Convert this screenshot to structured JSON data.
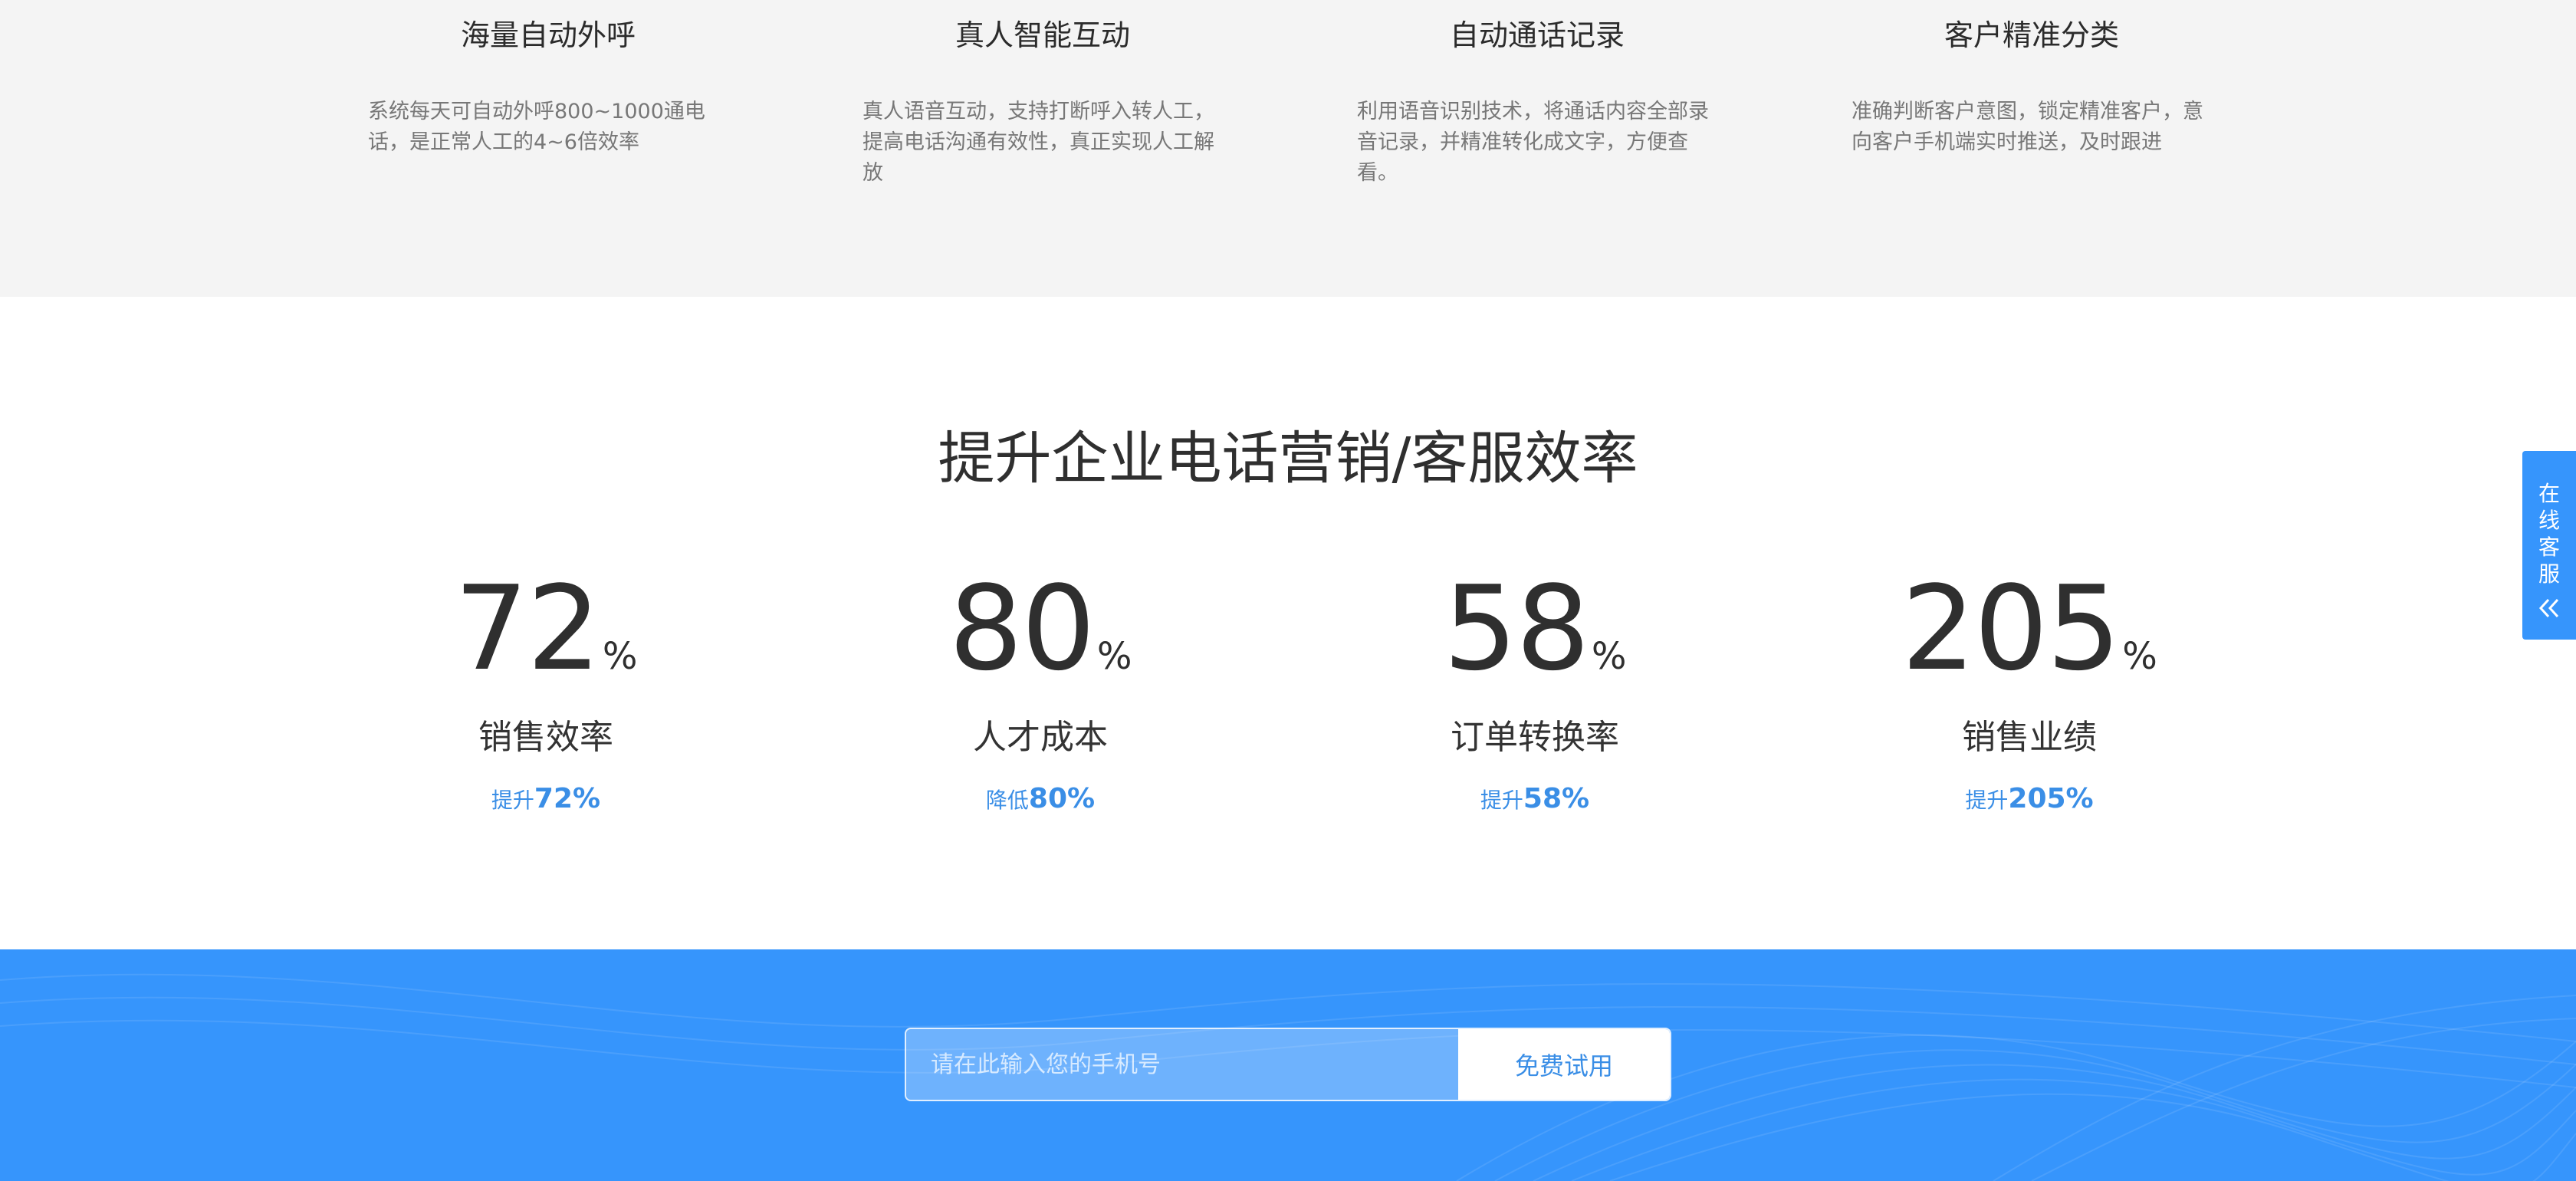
{
  "features": [
    {
      "title": "海量自动外呼",
      "desc": "系统每天可自动外呼800~1000通电话，是正常人工的4~6倍效率"
    },
    {
      "title": "真人智能互动",
      "desc": "真人语音互动，支持打断呼入转人工，提高电话沟通有效性，真正实现人工解放"
    },
    {
      "title": "自动通话记录",
      "desc": "利用语音识别技术，将通话内容全部录音记录，并精准转化成文字，方便查看。"
    },
    {
      "title": "客户精准分类",
      "desc": "准确判断客户意图，锁定精准客户，意向客户手机端实时推送，及时跟进"
    }
  ],
  "stats_section": {
    "title": "提升企业电话营销/客服效率",
    "items": [
      {
        "number": "72",
        "unit": "%",
        "label": "销售效率",
        "sub_prefix": "提升",
        "sub_value": "72%"
      },
      {
        "number": "80",
        "unit": "%",
        "label": "人才成本",
        "sub_prefix": "降低",
        "sub_value": "80%"
      },
      {
        "number": "58",
        "unit": "%",
        "label": "订单转换率",
        "sub_prefix": "提升",
        "sub_value": "58%"
      },
      {
        "number": "205",
        "unit": "%",
        "label": "销售业绩",
        "sub_prefix": "提升",
        "sub_value": "205%"
      }
    ]
  },
  "cta": {
    "phone_placeholder": "请在此输入您的手机号",
    "button_label": "免费试用"
  },
  "service_tab": {
    "label": "在线客服",
    "icon": "double-chevron-left-icon"
  },
  "colors": {
    "accent": "#3695fc",
    "accent_text": "#3a8ee6",
    "band_gray": "#f4f4f4"
  }
}
